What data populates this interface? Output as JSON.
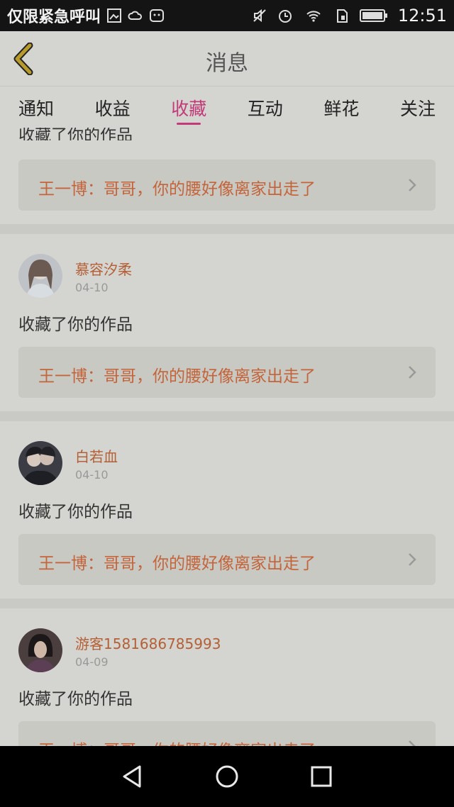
{
  "status_bar": {
    "carrier": "仅限紧急呼叫",
    "time": "12:51",
    "icons": [
      "image-icon",
      "cloud-icon",
      "android-icon",
      "mute-icon",
      "alarm-icon",
      "wifi-icon",
      "sim-icon",
      "battery-icon"
    ]
  },
  "header": {
    "title": "消息",
    "back_icon": "chevron-left-icon"
  },
  "tabs": [
    {
      "label": "通知",
      "active": false
    },
    {
      "label": "收益",
      "active": false
    },
    {
      "label": "收藏",
      "active": true
    },
    {
      "label": "互动",
      "active": false
    },
    {
      "label": "鲜花",
      "active": false
    },
    {
      "label": "关注",
      "active": false
    }
  ],
  "partial_item": {
    "action": "收藏了你的作品",
    "work": "王一博：哥哥，你的腰好像离家出走了"
  },
  "items": [
    {
      "username": "慕容汐柔",
      "date": "04-10",
      "action": "收藏了你的作品",
      "work": "王一博：哥哥，你的腰好像离家出走了"
    },
    {
      "username": "白若血",
      "date": "04-10",
      "action": "收藏了你的作品",
      "work": "王一博：哥哥，你的腰好像离家出走了"
    },
    {
      "username": "游客1581686785993",
      "date": "04-09",
      "action": "收藏了你的作品",
      "work": "王一博：哥哥，你的腰好像离家出走了"
    }
  ],
  "colors": {
    "accent": "#c23a78",
    "username": "#b45f35",
    "work_link": "#c4643a",
    "overlay_bg": "#d4d4d0"
  },
  "nav": [
    "back-icon",
    "home-icon",
    "recents-icon"
  ]
}
